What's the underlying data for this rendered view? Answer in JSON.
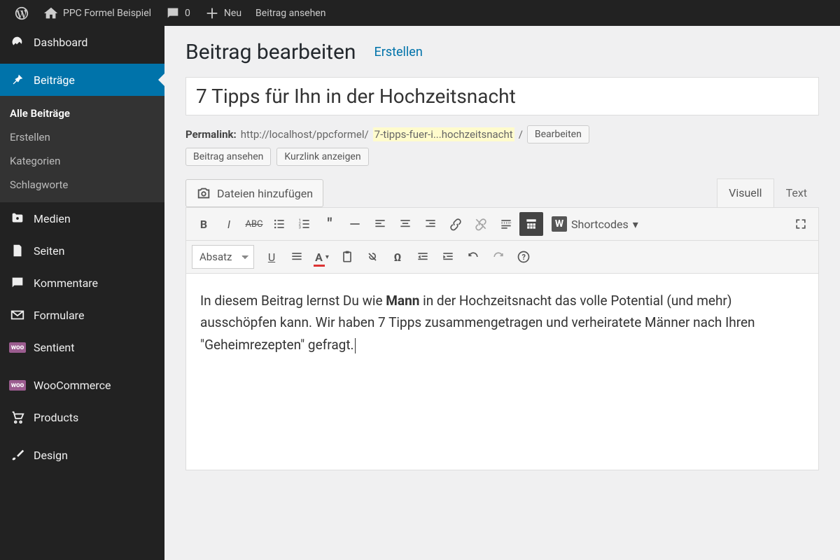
{
  "topbar": {
    "site_name": "PPC Formel Beispiel",
    "comments_count": "0",
    "new_label": "Neu",
    "view_post": "Beitrag ansehen"
  },
  "sidebar": {
    "dashboard": "Dashboard",
    "posts": "Beiträge",
    "posts_sub": {
      "all": "Alle Beiträge",
      "new": "Erstellen",
      "cats": "Kategorien",
      "tags": "Schlagworte"
    },
    "media": "Medien",
    "pages": "Seiten",
    "comments": "Kommentare",
    "forms": "Formulare",
    "sentient": "Sentient",
    "woo": "WooCommerce",
    "products": "Products",
    "design": "Design"
  },
  "header": {
    "title": "Beitrag bearbeiten",
    "create": "Erstellen"
  },
  "post": {
    "title": "7 Tipps für Ihn in der Hochzeitsnacht",
    "permalink_label": "Permalink:",
    "permalink_base": "http://localhost/ppcformel/",
    "permalink_slug": "7-tipps-fuer-i...hochzeitsnacht",
    "edit": "Bearbeiten",
    "view": "Beitrag ansehen",
    "shortlink": "Kurzlink anzeigen"
  },
  "editor": {
    "add_media": "Dateien hinzufügen",
    "tab_visual": "Visuell",
    "tab_text": "Text",
    "format": "Absatz",
    "shortcodes": "Shortcodes",
    "content_pre": "In diesem Beitrag lernst Du wie ",
    "content_bold": "Mann",
    "content_post": " in der Hochzeitsnacht das volle Potential (und mehr) ausschöpfen kann. Wir haben 7 Tipps zusammengetragen und verheiratete Männer nach Ihren \"Geheimrezepten\" gefragt."
  }
}
